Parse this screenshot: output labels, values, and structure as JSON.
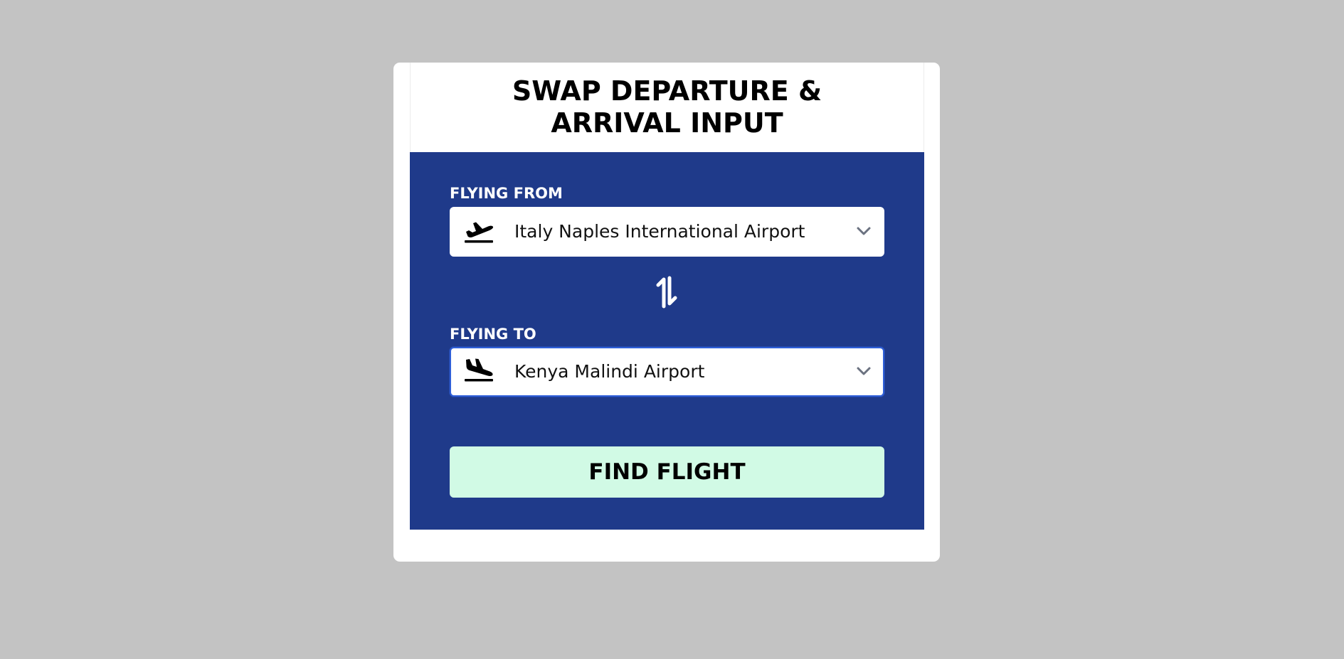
{
  "page": {
    "title": "SWAP DEPARTURE & ARRIVAL INPUT"
  },
  "form": {
    "from": {
      "label": "FLYING FROM",
      "value": "Italy Naples International Airport",
      "icon": "plane-departure-icon"
    },
    "swap": {
      "icon": "swap-arrows-icon"
    },
    "to": {
      "label": "FLYING TO",
      "value": "Kenya Malindi Airport",
      "icon": "plane-arrival-icon"
    },
    "submit_label": "FIND FLIGHT"
  },
  "colors": {
    "background": "#c3c3c3",
    "panel": "#1f3a8a",
    "button": "#d1fae5",
    "focus_border": "#2f5fd8"
  }
}
